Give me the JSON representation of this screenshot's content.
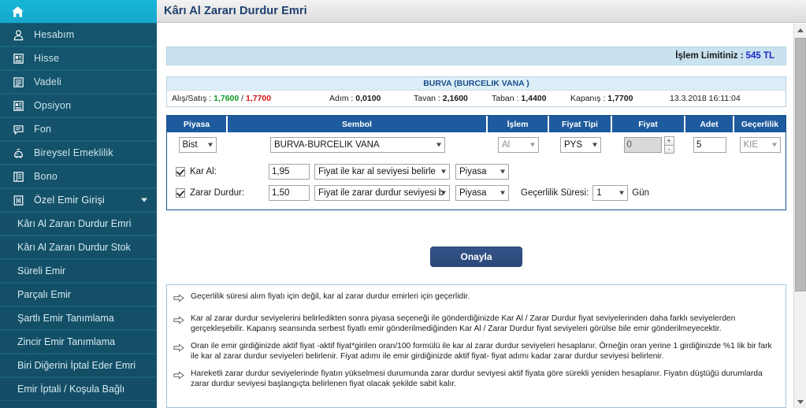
{
  "header": {
    "title": "Kârı Al Zararı Durdur Emri"
  },
  "sidebar": {
    "home_icon": "home-icon",
    "items": [
      {
        "label": "Hesabım",
        "icon": "user-icon"
      },
      {
        "label": "Hisse",
        "icon": "stock-book-icon"
      },
      {
        "label": "Vadeli",
        "icon": "list-icon"
      },
      {
        "label": "Opsiyon",
        "icon": "stock-book-icon"
      },
      {
        "label": "Fon",
        "icon": "chat-icon"
      },
      {
        "label": "Bireysel Emeklilik",
        "icon": "piggy-icon"
      },
      {
        "label": "Bono",
        "icon": "bond-icon"
      },
      {
        "label": "Özel Emir Girişi",
        "icon": "special-order-icon",
        "expanded": true
      }
    ],
    "sub_items": [
      {
        "label": "Kârı Al Zararı Durdur Emri"
      },
      {
        "label": "Kârı Al Zararı Durdur Stok"
      },
      {
        "label": "Süreli Emir"
      },
      {
        "label": "Parçalı Emir"
      },
      {
        "label": "Şartlı Emir Tanımlama"
      },
      {
        "label": "Zincir Emir Tanımlama"
      },
      {
        "label": "Biri Diğerini İptal Eder Emri"
      },
      {
        "label": "Emir İptali / Koşula Bağlı"
      }
    ]
  },
  "limit_bar": {
    "label": "İşlem Limitiniz :",
    "value": "545 TL",
    "value_color": "#1a27c9"
  },
  "symbol_panel": {
    "title": "BURVA  (BURCELIK VANA )",
    "bid_ask_label": "Alış/Satış :",
    "bid": "1,7600",
    "separator": "/",
    "ask": "1,7700",
    "bid_color": "#0e9c22",
    "ask_color": "#d81313",
    "step_label": "Adım :",
    "step": "0,0100",
    "ceiling_label": "Tavan :",
    "ceiling": "2,1600",
    "floor_label": "Taban :",
    "floor": "1,4400",
    "close_label": "Kapanış :",
    "close": "1,7700",
    "timestamp": "13.3.2018 16:11:04"
  },
  "order_table": {
    "columns": [
      "Piyasa",
      "Sembol",
      "İşlem",
      "Fiyat Tipi",
      "Fiyat",
      "Adet",
      "Geçerlilik"
    ],
    "row": {
      "piyasa": "Bist",
      "sembol": "BURVA-BURCELIK VANA",
      "islem": "Al",
      "fiyat_tipi": "PYS",
      "fiyat": "0",
      "spin_up": "+",
      "spin_down": "-",
      "adet": "5",
      "gecerlilik": "KIE"
    }
  },
  "conditions": {
    "kar_al": {
      "checked": true,
      "label": "Kar Al:",
      "amount": "1,95",
      "level_type": "Fiyat ile kar al seviyesi belirle",
      "market": "Piyasa"
    },
    "zarar_durdur": {
      "checked": true,
      "label": "Zarar Durdur:",
      "amount": "1,50",
      "level_type": "Fiyat ile zarar durdur seviyesi b",
      "market": "Piyasa",
      "validity_label": "Geçerlilik Süresi:",
      "validity_value": "1",
      "validity_unit": "Gün"
    }
  },
  "confirm_button": {
    "label": "Onayla"
  },
  "info_box": {
    "bullet_icon": "arrow-right-icon",
    "items": [
      "Geçerlilik süresi alım fiyatı için değil, kar al zarar durdur emirleri için geçerlidir.",
      "Kar al zarar durdur seviyelerini belirledikten sonra piyasa seçeneği ile gönderdiğinizde Kar Al / Zarar Durdur fiyat seviyelerinden daha farklı seviyelerden gerçekleşebilir. Kapanış seansında serbest fiyatlı emir gönderilmediğinden Kar Al / Zarar Durdur fiyat seviyeleri görülse bile emir gönderilmeyecektir.",
      "Oran ile emir girdiğinizde aktif fiyat -aktif fiyat*girilen oran/100 formülü ile kar al zarar durdur seviyeleri hesaplanır. Örneğin oran yerine 1 girdiğinizde %1 lik bir fark ile kar al zarar durdur seviyeleri belirlenir. Fiyat adımı ile emir girdiğinizde aktif fiyat- fiyat adımı kadar zarar durdur seviyesi belirlenir.",
      "Hareketli zarar durdur seviyelerinde fiyatın yükselmesi durumunda zarar durdur seviyesi aktif fiyata göre sürekli yeniden hesaplanır. Fiyatın düştüğü durumlarda zarar durdur seviyesi başlangıçta belirlenen fiyat olacak şekilde sabit kalır."
    ]
  },
  "scrollbar": {
    "up_arrow": "scroll-up-icon",
    "down_arrow": "scroll-down-icon",
    "thumb": "scroll-thumb"
  },
  "theme": {
    "sidebar_bg": "#15566e",
    "home_bg": "#17b6d8",
    "table_header_bg": "#1d5a9e",
    "accent_blue": "#1a27c9",
    "confirm_bg": "#34548a"
  }
}
